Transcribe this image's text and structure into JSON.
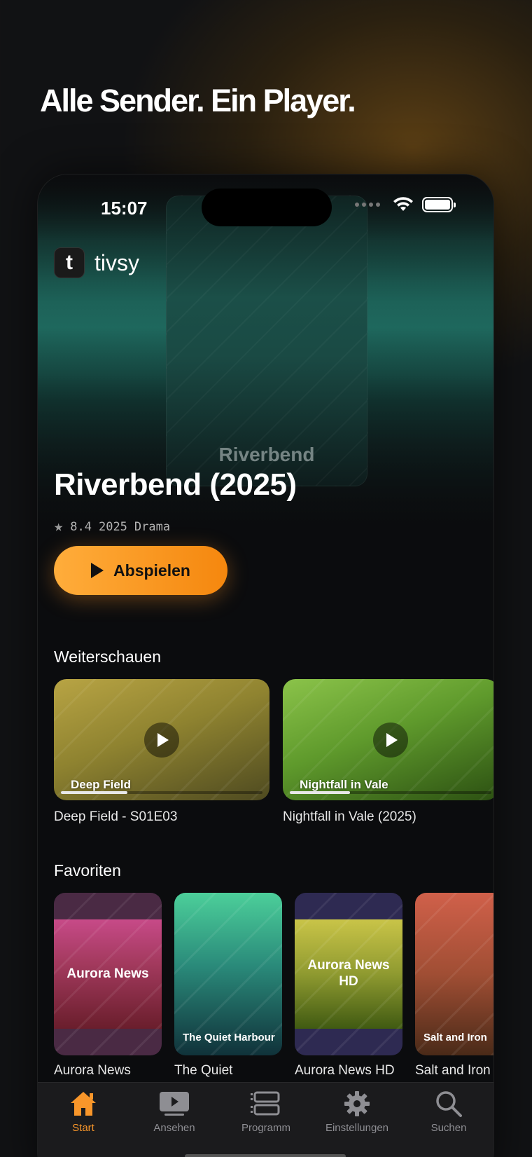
{
  "headline": "Alle Sender. Ein Player.",
  "status_bar": {
    "time": "15:07"
  },
  "app": {
    "logo_letter": "t",
    "name": "tivsy"
  },
  "hero": {
    "poster_title": "Riverbend",
    "title": "Riverbend (2025)",
    "rating": "8.4",
    "year": "2025",
    "genre": "Drama",
    "play_label": "Abspielen"
  },
  "continue_watching": {
    "title": "Weiterschauen",
    "items": [
      {
        "card_label": "Deep Field",
        "caption": "Deep Field - S01E03",
        "progress": 0.33
      },
      {
        "card_label": "Nightfall in Vale",
        "caption": "Nightfall in Vale (2025)",
        "progress": 0.3
      }
    ]
  },
  "favorites": {
    "title": "Favoriten",
    "items": [
      {
        "card_label": "Aurora News",
        "caption": "Aurora News"
      },
      {
        "card_label": "The Quiet Harbour",
        "caption": "The Quiet"
      },
      {
        "card_label": "Aurora News HD",
        "caption": "Aurora News HD"
      },
      {
        "card_label": "Salt and Iron",
        "caption": "Salt and Iron"
      }
    ]
  },
  "tabs": [
    {
      "label": "Start",
      "icon": "home-icon",
      "active": true
    },
    {
      "label": "Ansehen",
      "icon": "play-screen-icon"
    },
    {
      "label": "Programm",
      "icon": "guide-icon"
    },
    {
      "label": "Einstellungen",
      "icon": "gear-icon"
    },
    {
      "label": "Suchen",
      "icon": "search-icon"
    }
  ],
  "colors": {
    "accent": "#f8962a"
  }
}
